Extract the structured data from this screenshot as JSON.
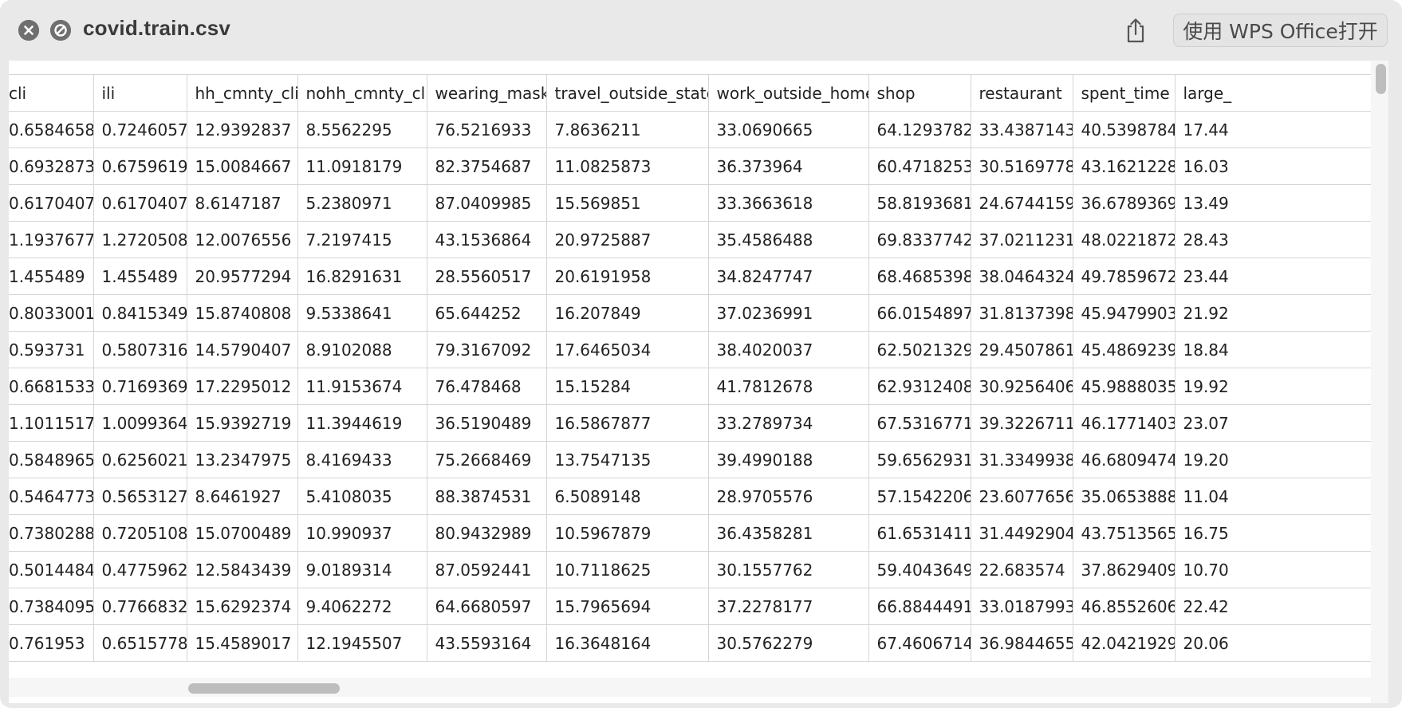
{
  "window": {
    "title": "covid.train.csv",
    "open_with_label": "使用 WPS Office打开",
    "buttons": {
      "close_icon": "close-icon",
      "noentry_icon": "no-entry-icon",
      "share_icon": "share-icon"
    }
  },
  "table": {
    "columns": [
      "cli",
      "ili",
      "hh_cmnty_cli",
      "nohh_cmnty_cli",
      "wearing_mask",
      "travel_outside_state",
      "work_outside_home",
      "shop",
      "restaurant",
      "spent_time",
      "large_"
    ],
    "rows": [
      [
        "0.6584658",
        "0.7246057",
        "12.9392837",
        "8.5562295",
        "76.5216933",
        "7.8636211",
        "33.0690665",
        "64.1293782",
        "33.4387143",
        "40.5398784",
        "17.44"
      ],
      [
        "0.6932873",
        "0.6759619",
        "15.0084667",
        "11.0918179",
        "82.3754687",
        "11.0825873",
        "36.373964",
        "60.4718253",
        "30.5169778",
        "43.1621228",
        "16.03"
      ],
      [
        "0.6170407",
        "0.6170407",
        "8.6147187",
        "5.2380971",
        "87.0409985",
        "15.569851",
        "33.3663618",
        "58.8193681",
        "24.6744159",
        "36.6789369",
        "13.49"
      ],
      [
        "1.1937677",
        "1.2720508",
        "12.0076556",
        "7.2197415",
        "43.1536864",
        "20.9725887",
        "35.4586488",
        "69.8337742",
        "37.0211231",
        "48.0221872",
        "28.43"
      ],
      [
        "1.455489",
        "1.455489",
        "20.9577294",
        "16.8291631",
        "28.5560517",
        "20.6191958",
        "34.8247747",
        "68.4685398",
        "38.0464324",
        "49.7859672",
        "23.44"
      ],
      [
        "0.8033001",
        "0.8415349",
        "15.8740808",
        "9.5338641",
        "65.644252",
        "16.207849",
        "37.0236991",
        "66.0154897",
        "31.8137398",
        "45.9479903",
        "21.92"
      ],
      [
        "0.593731",
        "0.5807316",
        "14.5790407",
        "8.9102088",
        "79.3167092",
        "17.6465034",
        "38.4020037",
        "62.5021329",
        "29.4507861",
        "45.4869239",
        "18.84"
      ],
      [
        "0.6681533",
        "0.7169369",
        "17.2295012",
        "11.9153674",
        "76.478468",
        "15.15284",
        "41.7812678",
        "62.9312408",
        "30.9256406",
        "45.9888035",
        "19.92"
      ],
      [
        "1.1011517",
        "1.0099364",
        "15.9392719",
        "11.3944619",
        "36.5190489",
        "16.5867877",
        "33.2789734",
        "67.5316771",
        "39.3226711",
        "46.1771403",
        "23.07"
      ],
      [
        "0.5848965",
        "0.6256021",
        "13.2347975",
        "8.4169433",
        "75.2668469",
        "13.7547135",
        "39.4990188",
        "59.6562931",
        "31.3349938",
        "46.6809474",
        "19.20"
      ],
      [
        "0.5464773",
        "0.5653127",
        "8.6461927",
        "5.4108035",
        "88.3874531",
        "6.5089148",
        "28.9705576",
        "57.1542206",
        "23.6077656",
        "35.0653888",
        "11.04"
      ],
      [
        "0.7380288",
        "0.7205108",
        "15.0700489",
        "10.990937",
        "80.9432989",
        "10.5967879",
        "36.4358281",
        "61.6531411",
        "31.4492904",
        "43.7513565",
        "16.75"
      ],
      [
        "0.5014484",
        "0.4775962",
        "12.5843439",
        "9.0189314",
        "87.0592441",
        "10.7118625",
        "30.1557762",
        "59.4043649",
        "22.683574",
        "37.8629409",
        "10.70"
      ],
      [
        "0.7384095",
        "0.7766832",
        "15.6292374",
        "9.4062272",
        "64.6680597",
        "15.7965694",
        "37.2278177",
        "66.8844491",
        "33.0187993",
        "46.8552606",
        "22.42"
      ],
      [
        "0.761953",
        "0.6515778",
        "15.4589017",
        "12.1945507",
        "43.5593164",
        "16.3648164",
        "30.5762279",
        "67.4606714",
        "36.9844655",
        "42.0421929",
        "20.06"
      ]
    ]
  }
}
